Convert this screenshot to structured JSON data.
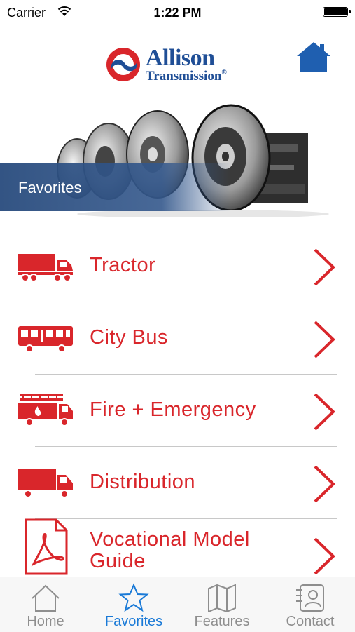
{
  "status_bar": {
    "carrier": "Carrier",
    "time": "1:22 PM"
  },
  "header": {
    "logo_line1": "Allison",
    "logo_line2": "Transmission",
    "logo_trademark": "®"
  },
  "hero": {
    "label": "Favorites"
  },
  "list": [
    {
      "label": "Tractor",
      "icon": "tractor-trailer-icon"
    },
    {
      "label": "City Bus",
      "icon": "bus-icon"
    },
    {
      "label": "Fire + Emergency",
      "icon": "fire-truck-icon"
    },
    {
      "label": "Distribution",
      "icon": "box-truck-icon"
    },
    {
      "label_line1": "Vocational Model",
      "label_line2": "Guide",
      "icon": "pdf-document-icon"
    }
  ],
  "tabs": [
    {
      "label": "Home",
      "icon": "house-outline-icon",
      "active": false
    },
    {
      "label": "Favorites",
      "icon": "star-outline-icon",
      "active": true
    },
    {
      "label": "Features",
      "icon": "map-fold-icon",
      "active": false
    },
    {
      "label": "Contact",
      "icon": "contact-card-icon",
      "active": false
    }
  ],
  "colors": {
    "brand_blue": "#1f4e96",
    "accent_red": "#d9262b",
    "tab_active": "#1a7ad7",
    "tab_inactive": "#8e8e8e",
    "favorites_band": "#34588c"
  }
}
